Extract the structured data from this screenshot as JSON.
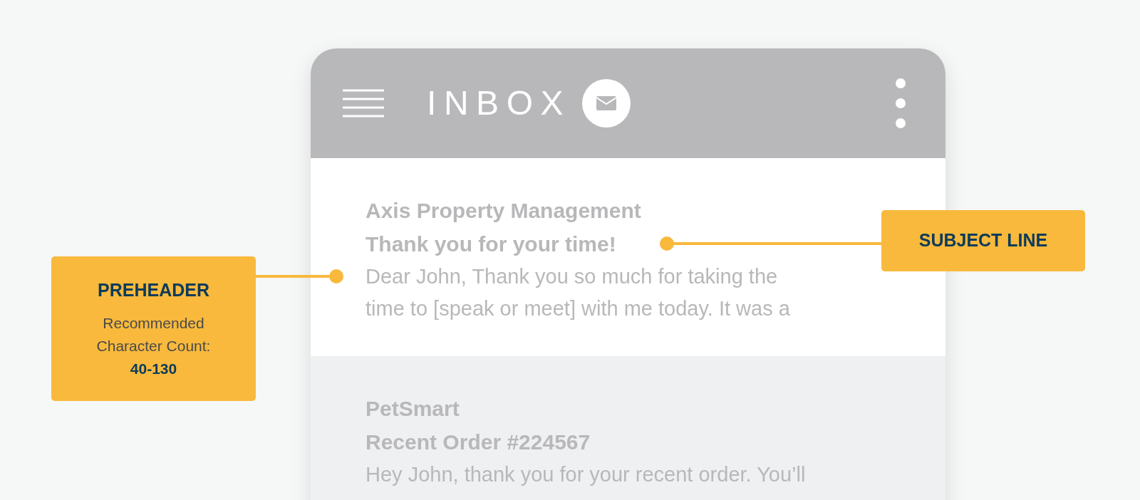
{
  "header": {
    "title": "INBOX"
  },
  "messages": [
    {
      "sender": "Axis Property Management",
      "subject": "Thank you for your time!",
      "preview_lines": [
        "Dear John, Thank you so much for taking the",
        "time to [speak or meet] with me today. It was a"
      ],
      "selected": true
    },
    {
      "sender": "PetSmart",
      "subject": "Recent Order #224567",
      "preview_lines": [
        "Hey John, thank you for your recent order. You’ll"
      ],
      "selected": false
    }
  ],
  "callouts": {
    "subject": {
      "title": "SUBJECT LINE"
    },
    "preheader": {
      "title": "PREHEADER",
      "note": "Recommended Character Count:",
      "count": "40-130"
    }
  }
}
